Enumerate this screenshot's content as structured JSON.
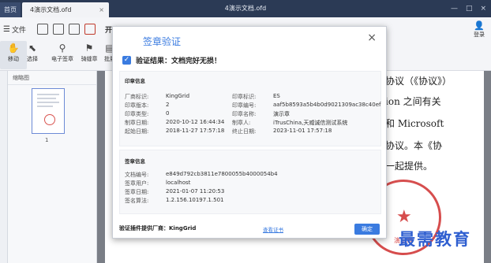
{
  "titlebar": {
    "home_tab": "首页",
    "doc_tab": "4演示文档.ofd",
    "doc_tab_close": "×",
    "window_title": "4演示文档.ofd",
    "minimize": "—",
    "maximize": "□",
    "close": "×"
  },
  "menu": {
    "file_label": "文件",
    "start_label": "开始"
  },
  "tools": [
    {
      "label": "移动",
      "icon": "hand-icon"
    },
    {
      "label": "选择",
      "icon": "select-arrow-icon"
    },
    {
      "label": "电子签章",
      "icon": "seal-icon"
    },
    {
      "label": "骑缝章",
      "icon": "seam-seal-icon"
    },
    {
      "label": "批量",
      "icon": "batch-icon"
    }
  ],
  "user_label": "登录",
  "thumb_panel": {
    "header": "缩略图",
    "page_number": "1"
  },
  "page_text": [
    "协议（《协议》）",
    "ion 之间有关",
    "和 Microsoft",
    "协议。本《协",
    "一起提供。"
  ],
  "stamp_name": "演示章",
  "watermark": "最需教育",
  "dialog": {
    "title": "签章验证",
    "close": "×",
    "verify_result": "验证结果：文档完好无损！",
    "seal_section_title": "印章信息",
    "seal_info": [
      {
        "key": "厂商标识:",
        "value": "KingGrid"
      },
      {
        "key": "印章标识:",
        "value": "ES"
      },
      {
        "key": "印章版本:",
        "value": "2"
      },
      {
        "key": "印章编号:",
        "value": "aaf5b8593a5b4b0d9021309ac38c40ef"
      },
      {
        "key": "印章类型:",
        "value": "0"
      },
      {
        "key": "印章名称:",
        "value": "演示章"
      },
      {
        "key": "制章日期:",
        "value": "2020-10-12 16:44:34"
      },
      {
        "key": "制章人:",
        "value": "iTrusChina,天威诚信测试系统"
      },
      {
        "key": "起始日期:",
        "value": "2018-11-27 17:57:18"
      },
      {
        "key": "终止日期:",
        "value": "2023-11-01 17:57:18"
      }
    ],
    "sign_section_title": "签章信息",
    "sign_info": [
      {
        "key": "文档编号:",
        "value": "e849d792cb3811e7800055b4000054b4"
      },
      {
        "key": "签章用户:",
        "value": "localhost"
      },
      {
        "key": "签章日期:",
        "value": "2021-01-07 11:20:53"
      },
      {
        "key": "签名算法:",
        "value": "1.2.156.10197.1.501"
      }
    ],
    "provider_label": "验证插件提供厂商：KingGrid",
    "cert_link": "查看证书",
    "ok_button": "确定"
  },
  "colors": {
    "accent": "#3a7be0",
    "titlebar": "#2b3a55",
    "stamp_red": "#cf2f2f",
    "watermark_blue": "#2f5fd0"
  }
}
